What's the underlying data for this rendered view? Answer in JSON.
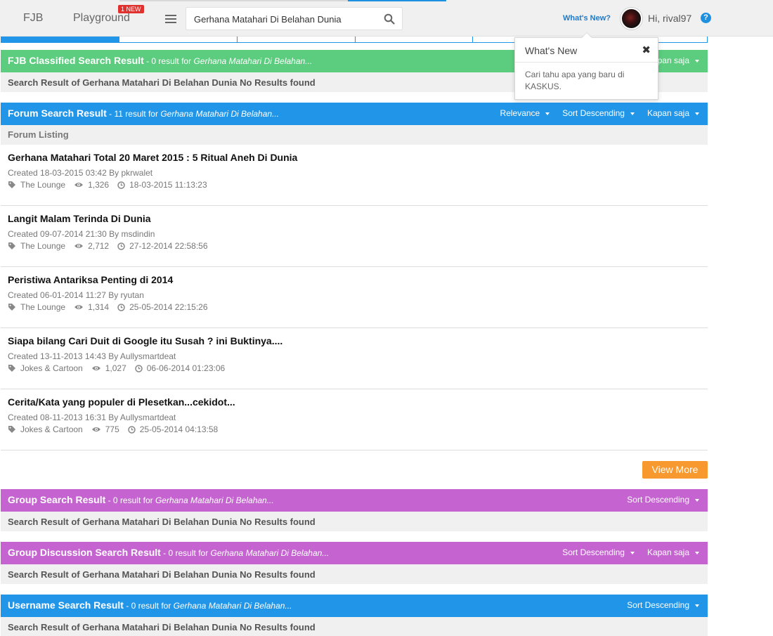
{
  "nav": {
    "fjb": "FJB",
    "playground": "Playground",
    "new_badge": "1 NEW",
    "search_value": "Gerhana Matahari Di Belahan Dunia",
    "whats_new": "What's New?",
    "greeting": "Hi, rival97",
    "help": "?"
  },
  "popover": {
    "title": "What's New",
    "close": "✖",
    "body": "Cari tahu apa yang baru di KASKUS."
  },
  "fjb_section": {
    "title": "FJB Classified Search Result",
    "count": " - 0 result for ",
    "query": "Gerhana Matahari Di Belahan...",
    "control": "Kapan saja",
    "no_result": "Search Result of Gerhana Matahari Di Belahan Dunia No Results found"
  },
  "forum_section": {
    "title": "Forum Search Result",
    "count": " - 11 result for ",
    "query": "Gerhana Matahari Di Belahan...",
    "controls": [
      "Relevance",
      "Sort Descending",
      "Kapan saja"
    ],
    "listing_label": "Forum Listing",
    "threads": [
      {
        "title": "Gerhana Matahari Total 20 Maret 2015 : 5 Ritual Aneh Di Dunia",
        "created": "Created 18-03-2015 03:42 By pkrwalet",
        "category": "The Lounge",
        "views": "1,326",
        "last": "18-03-2015 11:13:23"
      },
      {
        "title": "Langit Malam Terinda Di Dunia",
        "created": "Created 09-07-2014 21:30 By msdindin",
        "category": "The Lounge",
        "views": "2,712",
        "last": "27-12-2014 22:58:56"
      },
      {
        "title": "Peristiwa Antariksa Penting di 2014",
        "created": "Created 06-01-2014 11:27 By ryutan",
        "category": "The Lounge",
        "views": "1,314",
        "last": "25-05-2014 22:15:26"
      },
      {
        "title": "Siapa bilang Cari Duit di Google itu Susah ? ini Buktinya....",
        "created": "Created 13-11-2013 14:43 By Aullysmartdeat",
        "category": "Jokes & Cartoon",
        "views": "1,027",
        "last": "06-06-2014 01:23:06"
      },
      {
        "title": "Cerita/Kata yang populer di Plesetkan...cekidot...",
        "created": "Created 08-11-2013 16:31 By Aullysmartdeat",
        "category": "Jokes & Cartoon",
        "views": "775",
        "last": "25-05-2014 04:13:58"
      }
    ],
    "view_more": "View More"
  },
  "group_section": {
    "title": "Group Search Result",
    "count": " - 0 result for ",
    "query": "Gerhana Matahari Di Belahan...",
    "control": "Sort Descending",
    "no_result": "Search Result of Gerhana Matahari Di Belahan Dunia No Results found"
  },
  "group_discussion_section": {
    "title": "Group Discussion Search Result",
    "count": " - 0 result for ",
    "query": "Gerhana Matahari Di Belahan...",
    "controls": [
      "Sort Descending",
      "Kapan saja"
    ],
    "no_result": "Search Result of Gerhana Matahari Di Belahan Dunia No Results found"
  },
  "username_section": {
    "title": "Username Search Result",
    "count": " - 0 result for ",
    "query": "Gerhana Matahari Di Belahan...",
    "control": "Sort Descending",
    "no_result": "Search Result of Gerhana Matahari Di Belahan Dunia No Results found"
  },
  "colors": {
    "fjb_green": "#5ccc7f",
    "forum_blue": "#2196e8",
    "group_purple": "#c564d0",
    "view_more_orange": "#f7992e",
    "badge_red": "#e0312f"
  },
  "icons": {
    "menu": "hamburger-icon",
    "search": "search-icon",
    "category": "tags-icon",
    "views": "eye-icon",
    "time": "clock-icon",
    "close": "close-icon",
    "caret": "caret-down-icon"
  }
}
